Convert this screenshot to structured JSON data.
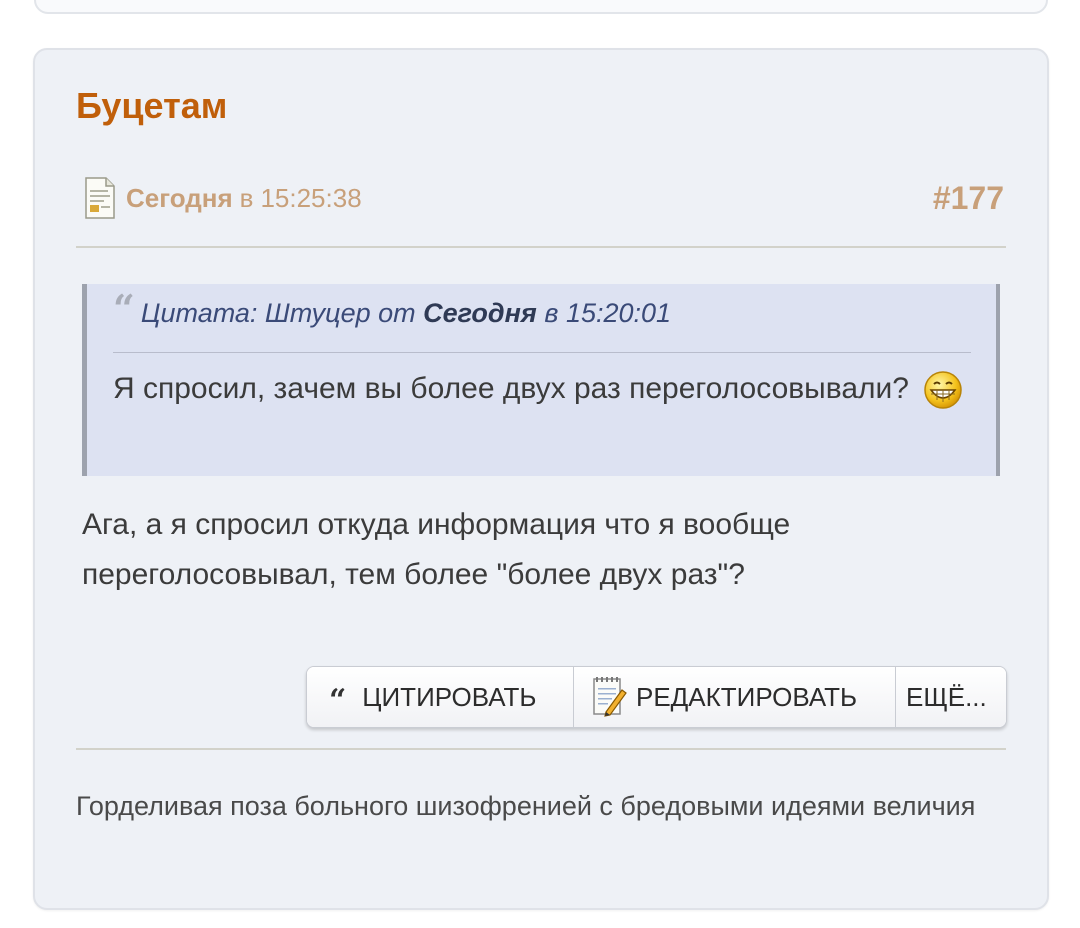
{
  "post": {
    "author": "Буцетам",
    "date_bold": "Сегодня",
    "date_in": "в",
    "time": "15:25:38",
    "number": "#177",
    "quote": {
      "prefix": "Цитата: Штуцер от",
      "date_bold": "Сегодня",
      "suffix": "в 15:20:01",
      "text": "Я спросил, зачем вы более двух раз переголосовывали?",
      "emoji": "grinning-smiley"
    },
    "body": "Ага, а я спросил откуда информация что я вообще переголосовывал, тем более \"более двух раз\"?",
    "actions": {
      "quote_label": "ЦИТИРОВАТЬ",
      "edit_label": "РЕДАКТИРОВАТЬ",
      "more_label": "ЕЩЁ..."
    },
    "signature": "Горделивая поза больного шизофренией с бредовыми идеями величия"
  },
  "colors": {
    "author": "#c05f0a",
    "meta": "#c8a07a",
    "quote_bg": "#dde2f2",
    "card_bg": "#eef1f6"
  }
}
